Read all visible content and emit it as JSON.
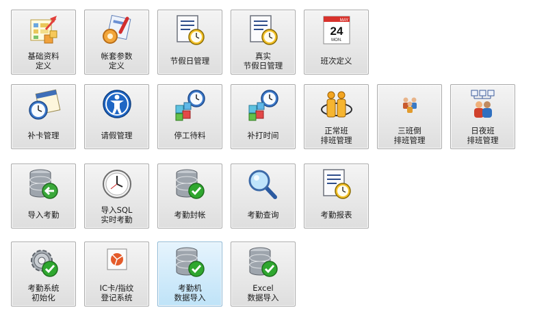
{
  "tiles": [
    {
      "id": "basic-data-definition",
      "label": "基础资料\n定义",
      "icon": "basic-data-icon"
    },
    {
      "id": "account-parameter-definition",
      "label": "帐套参数\n定义",
      "icon": "account-settings-icon"
    },
    {
      "id": "holiday-management",
      "label": "节假日管理",
      "icon": "document-clock-icon"
    },
    {
      "id": "actual-holiday-management",
      "label": "真实\n节假日管理",
      "icon": "document-clock-icon"
    },
    {
      "id": "shift-definition",
      "label": "班次定义",
      "icon": "calendar-icon",
      "calendar": {
        "month": "MAY",
        "day": "24",
        "weekday": "MON."
      }
    },
    {
      "id": "card-supplement-management",
      "label": "补卡管理",
      "icon": "calendar-clock-icon"
    },
    {
      "id": "leave-management",
      "label": "请假管理",
      "icon": "person-circle-icon"
    },
    {
      "id": "stop-work-material-wait",
      "label": "停工待料",
      "icon": "cubes-clock-icon"
    },
    {
      "id": "supplementary-punch-time",
      "label": "补打时间",
      "icon": "cubes-clock-icon"
    },
    {
      "id": "normal-shift-scheduling",
      "label": "正常班\n排班管理",
      "icon": "people-orange-icon"
    },
    {
      "id": "three-shift-scheduling",
      "label": "三班倒\n排班管理",
      "icon": "people-group-icon"
    },
    {
      "id": "day-night-shift-scheduling",
      "label": "日夜班\n排班管理",
      "icon": "people-network-icon"
    },
    {
      "id": "import-attendance",
      "label": "导入考勤",
      "icon": "database-import-icon"
    },
    {
      "id": "import-sql-realtime-attendance",
      "label": "导入SQL\n实时考勤",
      "icon": "clock-icon"
    },
    {
      "id": "attendance-close-account",
      "label": "考勤封帐",
      "icon": "database-check-icon"
    },
    {
      "id": "attendance-query",
      "label": "考勤查询",
      "icon": "magnifier-icon"
    },
    {
      "id": "attendance-report",
      "label": "考勤报表",
      "icon": "document-clock-icon"
    },
    {
      "id": "attendance-system-init",
      "label": "考勤系统\n初始化",
      "icon": "gear-check-icon"
    },
    {
      "id": "ic-card-fingerprint-registration",
      "label": "IC卡/指纹\n登记系统",
      "icon": "card-reader-icon"
    },
    {
      "id": "attendance-machine-data-import",
      "label": "考勤机\n数据导入",
      "icon": "database-check-icon",
      "selected": true
    },
    {
      "id": "excel-data-import",
      "label": "Excel\n数据导入",
      "icon": "database-check-icon"
    }
  ],
  "colors": {
    "tile_border": "#a9a9a9",
    "selected_bg": "#cde9fb",
    "check_green": "#2fa72f",
    "clock_gold": "#e8b400"
  }
}
